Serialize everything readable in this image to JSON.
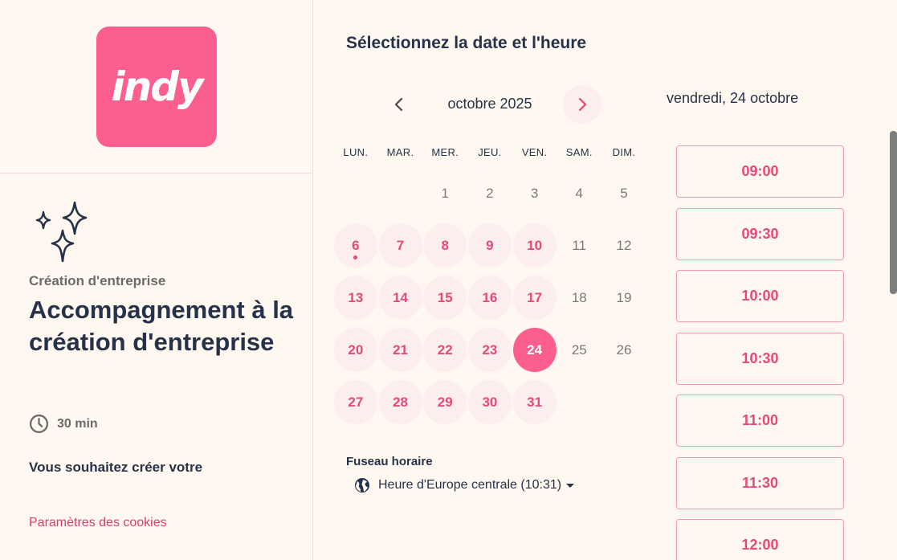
{
  "brand": {
    "logo_text": "indy",
    "color": "#fc5e8e"
  },
  "event": {
    "category": "Création d'entreprise",
    "title": "Accompagnement à la création d'entreprise",
    "duration": "30 min",
    "description": "Vous souhaitez créer votre",
    "cookies_link": "Paramètres des cookies"
  },
  "calendar": {
    "heading": "Sélectionnez la date et l'heure",
    "month": "octobre 2025",
    "weekdays": [
      "LUN.",
      "MAR.",
      "MER.",
      "JEU.",
      "VEN.",
      "SAM.",
      "DIM."
    ],
    "weeks": [
      [
        "",
        "",
        "1",
        "2",
        "3",
        "4",
        "5"
      ],
      [
        "6",
        "7",
        "8",
        "9",
        "10",
        "11",
        "12"
      ],
      [
        "13",
        "14",
        "15",
        "16",
        "17",
        "18",
        "19"
      ],
      [
        "20",
        "21",
        "22",
        "23",
        "24",
        "25",
        "26"
      ],
      [
        "27",
        "28",
        "29",
        "30",
        "31",
        "",
        ""
      ]
    ],
    "available": [
      "6",
      "7",
      "8",
      "9",
      "10",
      "13",
      "14",
      "15",
      "16",
      "17",
      "20",
      "21",
      "22",
      "23",
      "24",
      "27",
      "28",
      "29",
      "30",
      "31"
    ],
    "selected": "24",
    "today": "6",
    "timezone_label": "Fuseau horaire",
    "timezone_value": "Heure d'Europe centrale (10:31)"
  },
  "slots": {
    "date_heading": "vendredi, 24 octobre",
    "times": [
      "09:00",
      "09:30",
      "10:00",
      "10:30",
      "11:00",
      "11:30",
      "12:00"
    ]
  },
  "icons": {
    "prev": "chevron-left-icon",
    "next": "chevron-right-icon",
    "clock": "clock-icon",
    "globe": "globe-icon",
    "sparkles": "sparkles-icon"
  }
}
